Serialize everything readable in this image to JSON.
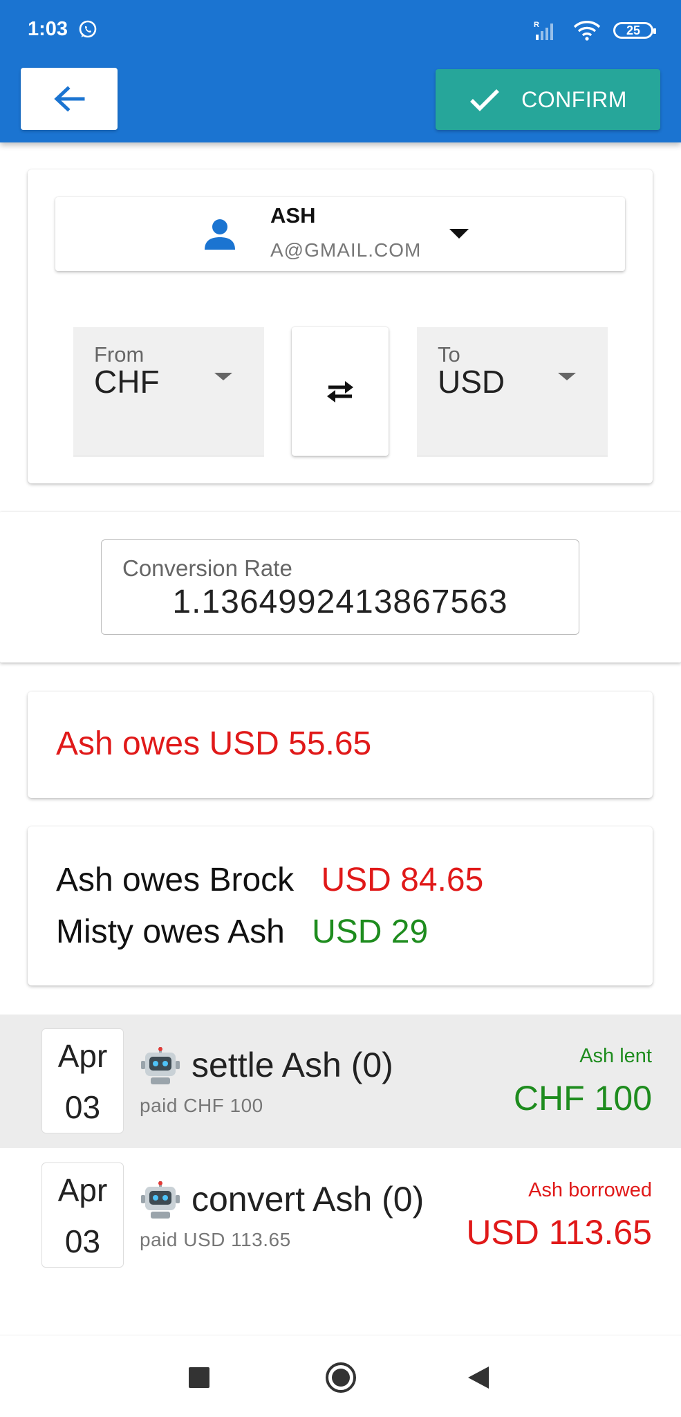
{
  "status_bar": {
    "time": "1:03",
    "battery": "25",
    "icons": [
      "whatsapp-icon",
      "signal-icon",
      "wifi-icon",
      "battery-icon"
    ]
  },
  "app_bar": {
    "back_icon": "arrow-back-icon",
    "confirm_label": "CONFIRM",
    "confirm_icon": "check-icon",
    "color": "#1b74d1",
    "confirm_color": "#26a69a"
  },
  "user": {
    "name": "ASH",
    "email": "A@GMAIL.COM",
    "icon": "person-icon",
    "accent": "#1b74d1"
  },
  "currency": {
    "from_label": "From",
    "from_value": "CHF",
    "to_label": "To",
    "to_value": "USD",
    "swap_icon": "swap-horiz-icon"
  },
  "conversion": {
    "label": "Conversion Rate",
    "value": "1.1364992413867563"
  },
  "total": {
    "text": "Ash owes USD 55.65"
  },
  "balances": [
    {
      "text": "Ash owes Brock",
      "amount": "USD 84.65",
      "color": "#e01919"
    },
    {
      "text": "Misty owes Ash",
      "amount": "USD 29",
      "color": "#1e8c1e"
    }
  ],
  "transactions": [
    {
      "month": "Apr",
      "day": "03",
      "title": "settle Ash (0)",
      "paid": "paid CHF 100",
      "kind": "Ash lent",
      "amount": "CHF 100",
      "color": "#1e8c1e",
      "highlighted": true
    },
    {
      "month": "Apr",
      "day": "03",
      "title": "convert Ash (0)",
      "paid": "paid USD 113.65",
      "kind": "Ash borrowed",
      "amount": "USD 113.65",
      "color": "#e01919",
      "highlighted": false
    }
  ],
  "nav_bar": {
    "icons": [
      "nav-recents-icon",
      "nav-home-icon",
      "nav-back-icon"
    ]
  }
}
